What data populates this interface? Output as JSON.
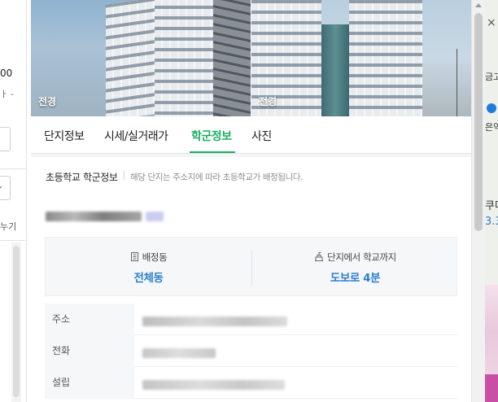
{
  "left_panel": {
    "price_fragment": "00",
    "note_fragment": "ㅏ -",
    "bottom_fragment": "누기"
  },
  "photos": [
    {
      "caption": "전경"
    },
    {
      "caption": "전경"
    }
  ],
  "tabs": [
    {
      "label": "단지정보",
      "active": false
    },
    {
      "label": "시세/실거래가",
      "active": false
    },
    {
      "label": "학군정보",
      "active": true
    },
    {
      "label": "사진",
      "active": false
    }
  ],
  "section": {
    "title": "초등학교 학군정보",
    "description": "해당 단지는 주소지에 따라 초등학교가 배정됩니다."
  },
  "info": {
    "assignment": {
      "label": "배정동",
      "value": "전체동",
      "icon": "building-icon"
    },
    "distance": {
      "label": "단지에서 학교까지",
      "value": "도보로 4분",
      "icon": "school-icon"
    }
  },
  "details": [
    {
      "label": "주소"
    },
    {
      "label": "전화"
    },
    {
      "label": "설립"
    }
  ],
  "map_fragments": {
    "close": "×",
    "place": "금고",
    "station": "은역",
    "label1": "쿠머",
    "label2": "3.3"
  },
  "colors": {
    "accent_green": "#1dae62",
    "value_blue": "#2d7fcb"
  }
}
